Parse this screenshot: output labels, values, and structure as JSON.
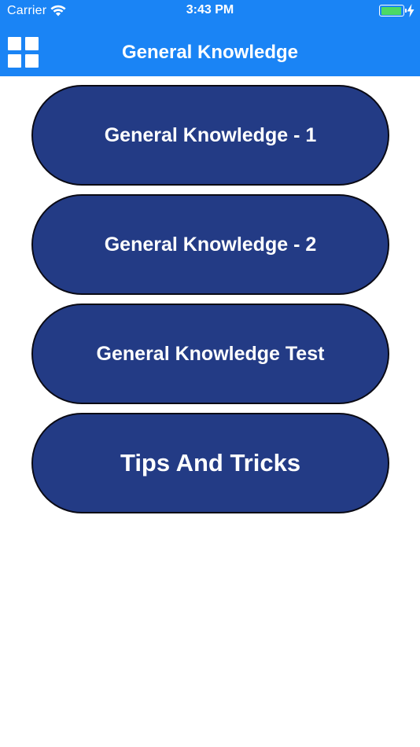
{
  "status_bar": {
    "carrier": "Carrier",
    "time": "3:43 PM",
    "battery_color": "#4cd964",
    "battery_level": 0.95
  },
  "nav_bar": {
    "title": "General Knowledge",
    "background_color": "#1a84f5",
    "menu_icon": "grid-icon"
  },
  "menu": {
    "button_color": "#233b85",
    "items": [
      {
        "label": "General Knowledge - 1"
      },
      {
        "label": "General Knowledge - 2"
      },
      {
        "label": "General Knowledge Test"
      },
      {
        "label": "Tips And Tricks"
      }
    ]
  }
}
